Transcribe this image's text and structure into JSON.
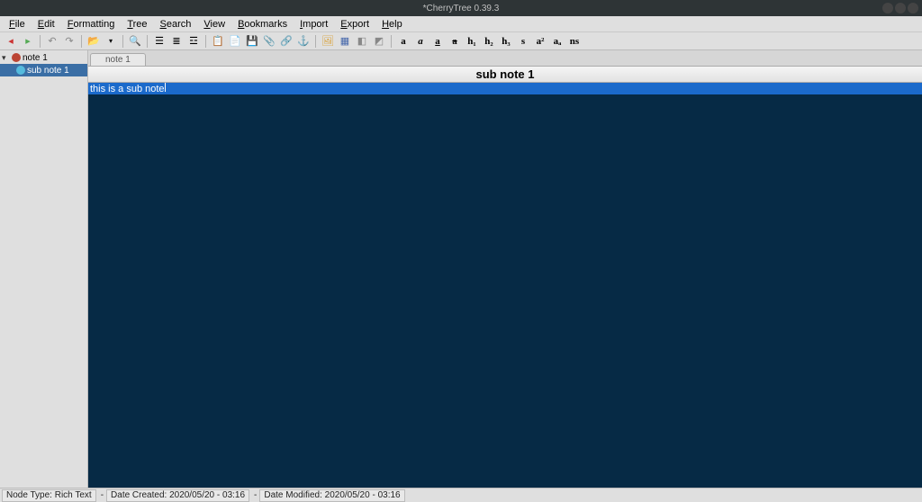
{
  "window": {
    "title": "*CherryTree 0.39.3"
  },
  "menu": {
    "file": "File",
    "edit": "Edit",
    "formatting": "Formatting",
    "tree": "Tree",
    "search": "Search",
    "view": "View",
    "bookmarks": "Bookmarks",
    "import": "Import",
    "export": "Export",
    "help": "Help"
  },
  "toolbar": {
    "bold": "a",
    "italic": "a",
    "underline": "a",
    "strike": "a",
    "h1": "h₁",
    "h2": "h₂",
    "h3": "h₃",
    "sub": "s",
    "sup_a2": "a²",
    "sup_a": "aₐ",
    "ns": "ns"
  },
  "tree": {
    "root": {
      "label": "note 1"
    },
    "child1": {
      "label": "sub note 1"
    }
  },
  "tabs": {
    "tab1": "note 1"
  },
  "header": {
    "title": "sub note 1"
  },
  "editor": {
    "line1": "this is a sub note"
  },
  "status": {
    "nodeType": "Node Type: Rich Text",
    "created": "Date Created: 2020/05/20 - 03:16",
    "modified": "Date Modified: 2020/05/20 - 03:16",
    "sep": "-"
  }
}
